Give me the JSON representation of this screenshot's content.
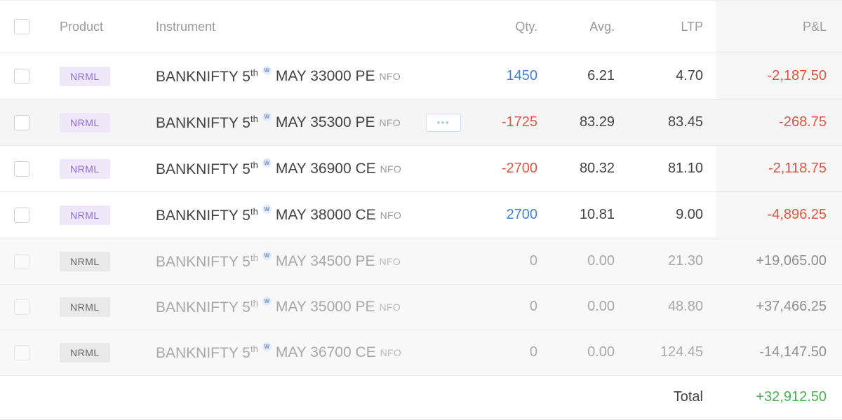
{
  "header": {
    "product": "Product",
    "instrument": "Instrument",
    "qty": "Qty.",
    "avg": "Avg.",
    "ltp": "LTP",
    "pl": "P&L"
  },
  "positions": [
    {
      "product": "NRML",
      "symbol": "BANKNIFTY 5",
      "ordinal": "th",
      "weekly": "W",
      "contract": "MAY 33000 PE",
      "exchange": "NFO",
      "qty": "1450",
      "avg": "6.21",
      "ltp": "4.70",
      "pl": "-2,187.50"
    },
    {
      "product": "NRML",
      "symbol": "BANKNIFTY 5",
      "ordinal": "th",
      "weekly": "W",
      "contract": "MAY 35300 PE",
      "exchange": "NFO",
      "qty": "-1725",
      "avg": "83.29",
      "ltp": "83.45",
      "pl": "-268.75",
      "more": "•••"
    },
    {
      "product": "NRML",
      "symbol": "BANKNIFTY 5",
      "ordinal": "th",
      "weekly": "W",
      "contract": "MAY 36900 CE",
      "exchange": "NFO",
      "qty": "-2700",
      "avg": "80.32",
      "ltp": "81.10",
      "pl": "-2,118.75"
    },
    {
      "product": "NRML",
      "symbol": "BANKNIFTY 5",
      "ordinal": "th",
      "weekly": "W",
      "contract": "MAY 38000 CE",
      "exchange": "NFO",
      "qty": "2700",
      "avg": "10.81",
      "ltp": "9.00",
      "pl": "-4,896.25"
    },
    {
      "product": "NRML",
      "symbol": "BANKNIFTY 5",
      "ordinal": "th",
      "weekly": "W",
      "contract": "MAY 34500 PE",
      "exchange": "NFO",
      "qty": "0",
      "avg": "0.00",
      "ltp": "21.30",
      "pl": "+19,065.00"
    },
    {
      "product": "NRML",
      "symbol": "BANKNIFTY 5",
      "ordinal": "th",
      "weekly": "W",
      "contract": "MAY 35000 PE",
      "exchange": "NFO",
      "qty": "0",
      "avg": "0.00",
      "ltp": "48.80",
      "pl": "+37,466.25"
    },
    {
      "product": "NRML",
      "symbol": "BANKNIFTY 5",
      "ordinal": "th",
      "weekly": "W",
      "contract": "MAY 36700 CE",
      "exchange": "NFO",
      "qty": "0",
      "avg": "0.00",
      "ltp": "124.45",
      "pl": "-14,147.50"
    }
  ],
  "footer": {
    "total_label": "Total",
    "total_value": "+32,912.50"
  },
  "colors": {
    "loss": "#e0573f",
    "profit": "#4caf50",
    "long_qty": "#4a7fd4",
    "short_qty": "#e0573f",
    "product_badge": "#8e6bd3"
  }
}
